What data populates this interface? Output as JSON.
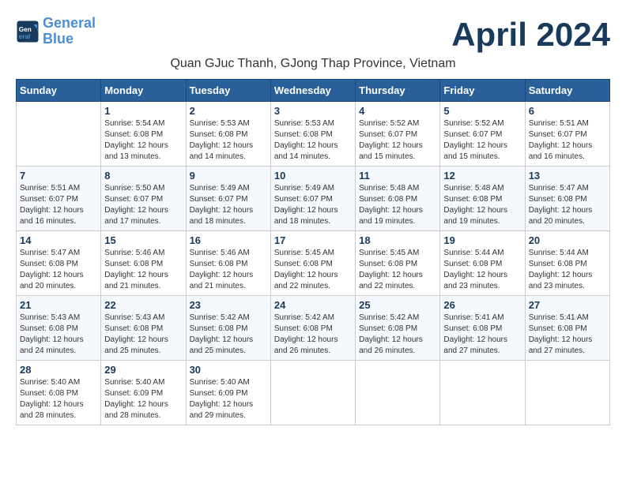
{
  "header": {
    "logo_line1": "General",
    "logo_line2": "Blue",
    "month_title": "April 2024",
    "subtitle": "Quan GJuc Thanh, GJong Thap Province, Vietnam"
  },
  "days_of_week": [
    "Sunday",
    "Monday",
    "Tuesday",
    "Wednesday",
    "Thursday",
    "Friday",
    "Saturday"
  ],
  "weeks": [
    [
      {
        "day": "",
        "info": ""
      },
      {
        "day": "1",
        "info": "Sunrise: 5:54 AM\nSunset: 6:08 PM\nDaylight: 12 hours\nand 13 minutes."
      },
      {
        "day": "2",
        "info": "Sunrise: 5:53 AM\nSunset: 6:08 PM\nDaylight: 12 hours\nand 14 minutes."
      },
      {
        "day": "3",
        "info": "Sunrise: 5:53 AM\nSunset: 6:08 PM\nDaylight: 12 hours\nand 14 minutes."
      },
      {
        "day": "4",
        "info": "Sunrise: 5:52 AM\nSunset: 6:07 PM\nDaylight: 12 hours\nand 15 minutes."
      },
      {
        "day": "5",
        "info": "Sunrise: 5:52 AM\nSunset: 6:07 PM\nDaylight: 12 hours\nand 15 minutes."
      },
      {
        "day": "6",
        "info": "Sunrise: 5:51 AM\nSunset: 6:07 PM\nDaylight: 12 hours\nand 16 minutes."
      }
    ],
    [
      {
        "day": "7",
        "info": "Sunrise: 5:51 AM\nSunset: 6:07 PM\nDaylight: 12 hours\nand 16 minutes."
      },
      {
        "day": "8",
        "info": "Sunrise: 5:50 AM\nSunset: 6:07 PM\nDaylight: 12 hours\nand 17 minutes."
      },
      {
        "day": "9",
        "info": "Sunrise: 5:49 AM\nSunset: 6:07 PM\nDaylight: 12 hours\nand 18 minutes."
      },
      {
        "day": "10",
        "info": "Sunrise: 5:49 AM\nSunset: 6:07 PM\nDaylight: 12 hours\nand 18 minutes."
      },
      {
        "day": "11",
        "info": "Sunrise: 5:48 AM\nSunset: 6:08 PM\nDaylight: 12 hours\nand 19 minutes."
      },
      {
        "day": "12",
        "info": "Sunrise: 5:48 AM\nSunset: 6:08 PM\nDaylight: 12 hours\nand 19 minutes."
      },
      {
        "day": "13",
        "info": "Sunrise: 5:47 AM\nSunset: 6:08 PM\nDaylight: 12 hours\nand 20 minutes."
      }
    ],
    [
      {
        "day": "14",
        "info": "Sunrise: 5:47 AM\nSunset: 6:08 PM\nDaylight: 12 hours\nand 20 minutes."
      },
      {
        "day": "15",
        "info": "Sunrise: 5:46 AM\nSunset: 6:08 PM\nDaylight: 12 hours\nand 21 minutes."
      },
      {
        "day": "16",
        "info": "Sunrise: 5:46 AM\nSunset: 6:08 PM\nDaylight: 12 hours\nand 21 minutes."
      },
      {
        "day": "17",
        "info": "Sunrise: 5:45 AM\nSunset: 6:08 PM\nDaylight: 12 hours\nand 22 minutes."
      },
      {
        "day": "18",
        "info": "Sunrise: 5:45 AM\nSunset: 6:08 PM\nDaylight: 12 hours\nand 22 minutes."
      },
      {
        "day": "19",
        "info": "Sunrise: 5:44 AM\nSunset: 6:08 PM\nDaylight: 12 hours\nand 23 minutes."
      },
      {
        "day": "20",
        "info": "Sunrise: 5:44 AM\nSunset: 6:08 PM\nDaylight: 12 hours\nand 23 minutes."
      }
    ],
    [
      {
        "day": "21",
        "info": "Sunrise: 5:43 AM\nSunset: 6:08 PM\nDaylight: 12 hours\nand 24 minutes."
      },
      {
        "day": "22",
        "info": "Sunrise: 5:43 AM\nSunset: 6:08 PM\nDaylight: 12 hours\nand 25 minutes."
      },
      {
        "day": "23",
        "info": "Sunrise: 5:42 AM\nSunset: 6:08 PM\nDaylight: 12 hours\nand 25 minutes."
      },
      {
        "day": "24",
        "info": "Sunrise: 5:42 AM\nSunset: 6:08 PM\nDaylight: 12 hours\nand 26 minutes."
      },
      {
        "day": "25",
        "info": "Sunrise: 5:42 AM\nSunset: 6:08 PM\nDaylight: 12 hours\nand 26 minutes."
      },
      {
        "day": "26",
        "info": "Sunrise: 5:41 AM\nSunset: 6:08 PM\nDaylight: 12 hours\nand 27 minutes."
      },
      {
        "day": "27",
        "info": "Sunrise: 5:41 AM\nSunset: 6:08 PM\nDaylight: 12 hours\nand 27 minutes."
      }
    ],
    [
      {
        "day": "28",
        "info": "Sunrise: 5:40 AM\nSunset: 6:08 PM\nDaylight: 12 hours\nand 28 minutes."
      },
      {
        "day": "29",
        "info": "Sunrise: 5:40 AM\nSunset: 6:09 PM\nDaylight: 12 hours\nand 28 minutes."
      },
      {
        "day": "30",
        "info": "Sunrise: 5:40 AM\nSunset: 6:09 PM\nDaylight: 12 hours\nand 29 minutes."
      },
      {
        "day": "",
        "info": ""
      },
      {
        "day": "",
        "info": ""
      },
      {
        "day": "",
        "info": ""
      },
      {
        "day": "",
        "info": ""
      }
    ]
  ]
}
